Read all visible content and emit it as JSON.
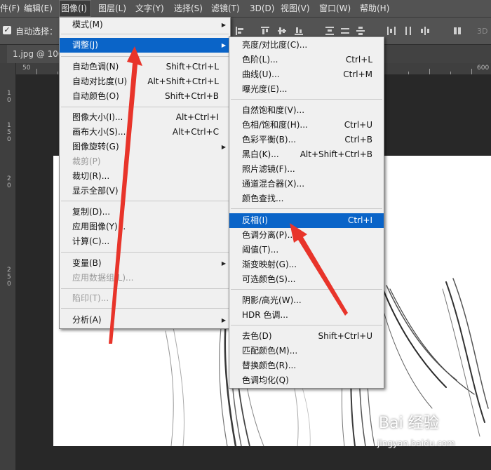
{
  "menubar": {
    "items": [
      "件(F)",
      "编辑(E)",
      "图像(I)",
      "图层(L)",
      "文字(Y)",
      "选择(S)",
      "滤镜(T)",
      "3D(D)",
      "视图(V)",
      "窗口(W)",
      "帮助(H)"
    ],
    "active": "图像(I)"
  },
  "options": {
    "auto_select_label": "自动选择：",
    "mode_3d": "3D"
  },
  "document": {
    "tab_title": "1.jpg @ 100"
  },
  "ruler": {
    "h_labels": [
      "50",
      "600"
    ],
    "v_labels": [
      "1",
      "0",
      "1",
      "5",
      "0",
      "2",
      "0",
      "2",
      "5",
      "0"
    ]
  },
  "image_menu": {
    "items": [
      {
        "label": "模式(M)",
        "shortcut": "",
        "submenu": true
      },
      {
        "label": "调整(J)",
        "shortcut": "",
        "submenu": true,
        "highlighted": true
      },
      {
        "label": "自动色调(N)",
        "shortcut": "Shift+Ctrl+L"
      },
      {
        "label": "自动对比度(U)",
        "shortcut": "Alt+Shift+Ctrl+L"
      },
      {
        "label": "自动颜色(O)",
        "shortcut": "Shift+Ctrl+B"
      },
      {
        "label": "图像大小(I)...",
        "shortcut": "Alt+Ctrl+I"
      },
      {
        "label": "画布大小(S)...",
        "shortcut": "Alt+Ctrl+C"
      },
      {
        "label": "图像旋转(G)",
        "shortcut": "",
        "submenu": true
      },
      {
        "label": "裁剪(P)",
        "shortcut": "",
        "disabled": true
      },
      {
        "label": "裁切(R)...",
        "shortcut": ""
      },
      {
        "label": "显示全部(V)",
        "shortcut": ""
      },
      {
        "label": "复制(D)...",
        "shortcut": ""
      },
      {
        "label": "应用图像(Y)...",
        "shortcut": ""
      },
      {
        "label": "计算(C)...",
        "shortcut": ""
      },
      {
        "label": "变量(B)",
        "shortcut": "",
        "submenu": true
      },
      {
        "label": "应用数据组(L)...",
        "shortcut": "",
        "disabled": true
      },
      {
        "label": "陷印(T)...",
        "shortcut": "",
        "disabled": true
      },
      {
        "label": "分析(A)",
        "shortcut": "",
        "submenu": true
      }
    ]
  },
  "adjust_menu": {
    "items": [
      {
        "label": "亮度/对比度(C)...",
        "shortcut": ""
      },
      {
        "label": "色阶(L)...",
        "shortcut": "Ctrl+L"
      },
      {
        "label": "曲线(U)...",
        "shortcut": "Ctrl+M"
      },
      {
        "label": "曝光度(E)...",
        "shortcut": ""
      },
      {
        "label": "自然饱和度(V)...",
        "shortcut": ""
      },
      {
        "label": "色相/饱和度(H)...",
        "shortcut": "Ctrl+U"
      },
      {
        "label": "色彩平衡(B)...",
        "shortcut": "Ctrl+B"
      },
      {
        "label": "黑白(K)...",
        "shortcut": "Alt+Shift+Ctrl+B"
      },
      {
        "label": "照片滤镜(F)...",
        "shortcut": ""
      },
      {
        "label": "通道混合器(X)...",
        "shortcut": ""
      },
      {
        "label": "颜色查找...",
        "shortcut": ""
      },
      {
        "label": "反相(I)",
        "shortcut": "Ctrl+I",
        "highlighted": true
      },
      {
        "label": "色调分离(P)...",
        "shortcut": ""
      },
      {
        "label": "阈值(T)...",
        "shortcut": ""
      },
      {
        "label": "渐变映射(G)...",
        "shortcut": ""
      },
      {
        "label": "可选颜色(S)...",
        "shortcut": ""
      },
      {
        "label": "阴影/高光(W)...",
        "shortcut": ""
      },
      {
        "label": "HDR 色调...",
        "shortcut": ""
      },
      {
        "label": "去色(D)",
        "shortcut": "Shift+Ctrl+U"
      },
      {
        "label": "匹配颜色(M)...",
        "shortcut": ""
      },
      {
        "label": "替换颜色(R)...",
        "shortcut": ""
      },
      {
        "label": "色调均化(Q)",
        "shortcut": ""
      }
    ]
  },
  "watermark": {
    "big": "Bai 经验",
    "url": "jingyan.baidu.com"
  },
  "colors": {
    "highlight": "#0a64c8",
    "arrow": "#e8342a",
    "menubar": "#535353"
  }
}
